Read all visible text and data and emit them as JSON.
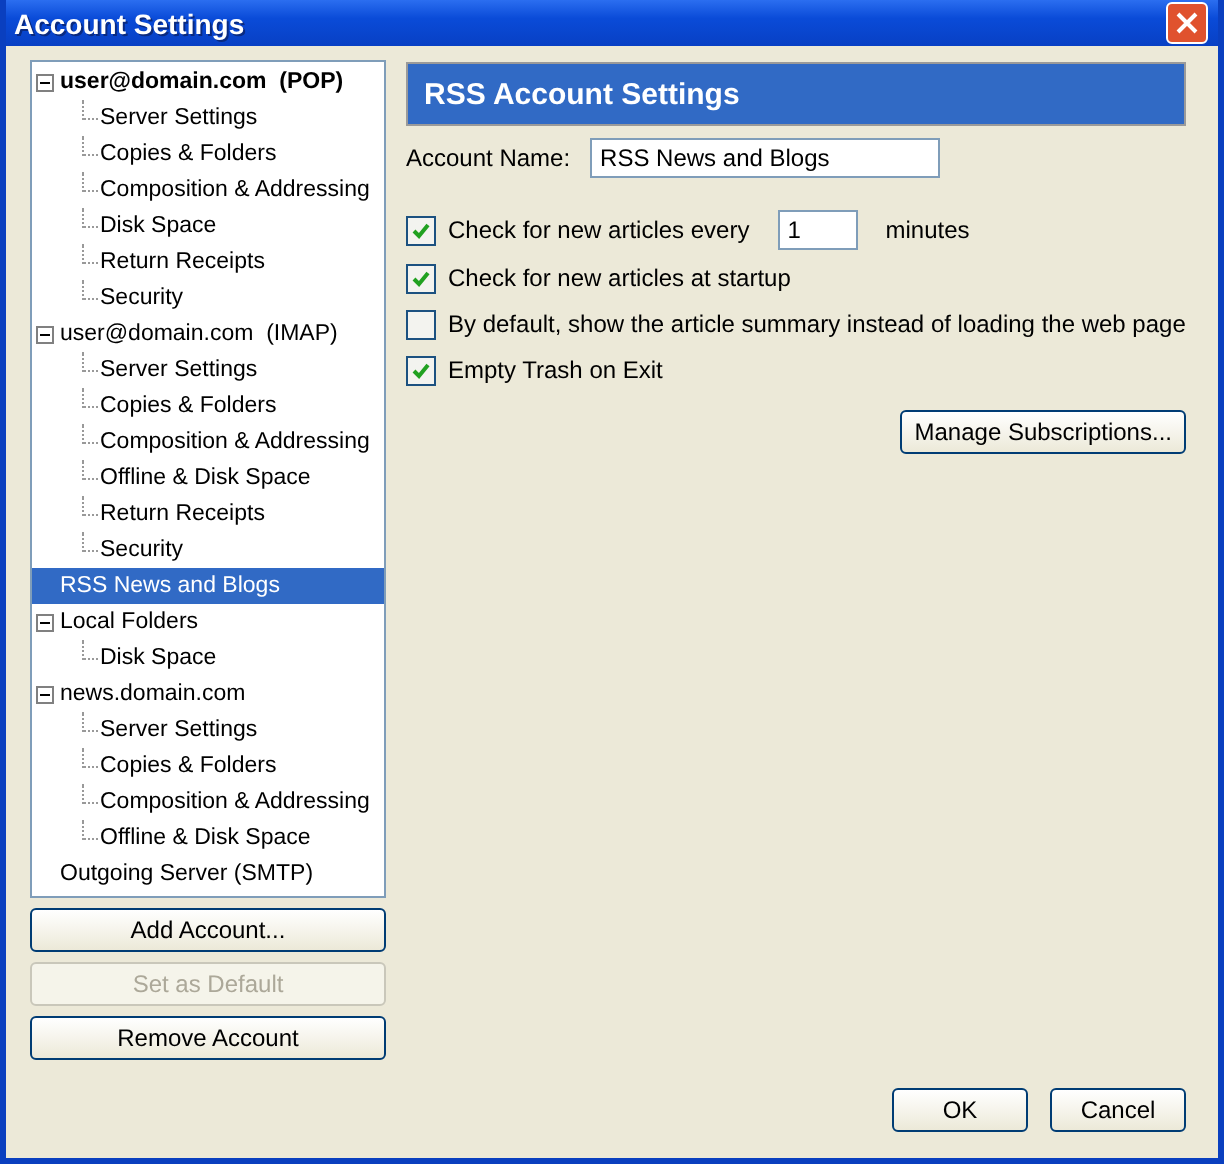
{
  "window": {
    "title": "Account Settings"
  },
  "tree": [
    {
      "label": "user@domain.com  (POP)",
      "default": true,
      "expanded": true,
      "selected": false,
      "children": [
        {
          "label": "Server Settings",
          "selected": false
        },
        {
          "label": "Copies & Folders",
          "selected": false
        },
        {
          "label": "Composition & Addressing",
          "selected": false
        },
        {
          "label": "Disk Space",
          "selected": false
        },
        {
          "label": "Return Receipts",
          "selected": false
        },
        {
          "label": "Security",
          "selected": false
        }
      ]
    },
    {
      "label": "user@domain.com  (IMAP)",
      "default": false,
      "expanded": true,
      "selected": false,
      "children": [
        {
          "label": "Server Settings",
          "selected": false
        },
        {
          "label": "Copies & Folders",
          "selected": false
        },
        {
          "label": "Composition & Addressing",
          "selected": false
        },
        {
          "label": "Offline & Disk Space",
          "selected": false
        },
        {
          "label": "Return Receipts",
          "selected": false
        },
        {
          "label": "Security",
          "selected": false
        }
      ]
    },
    {
      "label": "RSS News and Blogs",
      "default": false,
      "selected": true
    },
    {
      "label": "Local Folders",
      "default": false,
      "expanded": true,
      "selected": false,
      "children": [
        {
          "label": "Disk Space",
          "selected": false
        }
      ]
    },
    {
      "label": "news.domain.com",
      "default": false,
      "expanded": true,
      "selected": false,
      "children": [
        {
          "label": "Server Settings",
          "selected": false
        },
        {
          "label": "Copies & Folders",
          "selected": false
        },
        {
          "label": "Composition & Addressing",
          "selected": false
        },
        {
          "label": "Offline & Disk Space",
          "selected": false
        }
      ]
    },
    {
      "label": "Outgoing Server (SMTP)",
      "default": false,
      "selected": false
    }
  ],
  "tree_buttons": [
    {
      "label": "Add Account...",
      "disabled": false
    },
    {
      "label": "Set as Default",
      "disabled": true
    },
    {
      "label": "Remove Account",
      "disabled": false
    }
  ],
  "panel": {
    "title": "RSS Account Settings",
    "account_name_label": "Account Name:",
    "account_name": "RSS News and Blogs",
    "options": [
      {
        "kind": "interval",
        "label": "Check for new articles every",
        "checked": true,
        "value": "1",
        "suffix": "minutes"
      },
      {
        "kind": "checkbox",
        "label": "Check for new articles at startup",
        "checked": true
      },
      {
        "kind": "checkbox",
        "label": "By default, show the article summary instead of loading the web page",
        "checked": false
      },
      {
        "kind": "checkbox",
        "label": "Empty Trash on Exit",
        "checked": true
      }
    ],
    "manage_button": "Manage Subscriptions..."
  },
  "dialog_buttons": [
    "OK",
    "Cancel"
  ]
}
